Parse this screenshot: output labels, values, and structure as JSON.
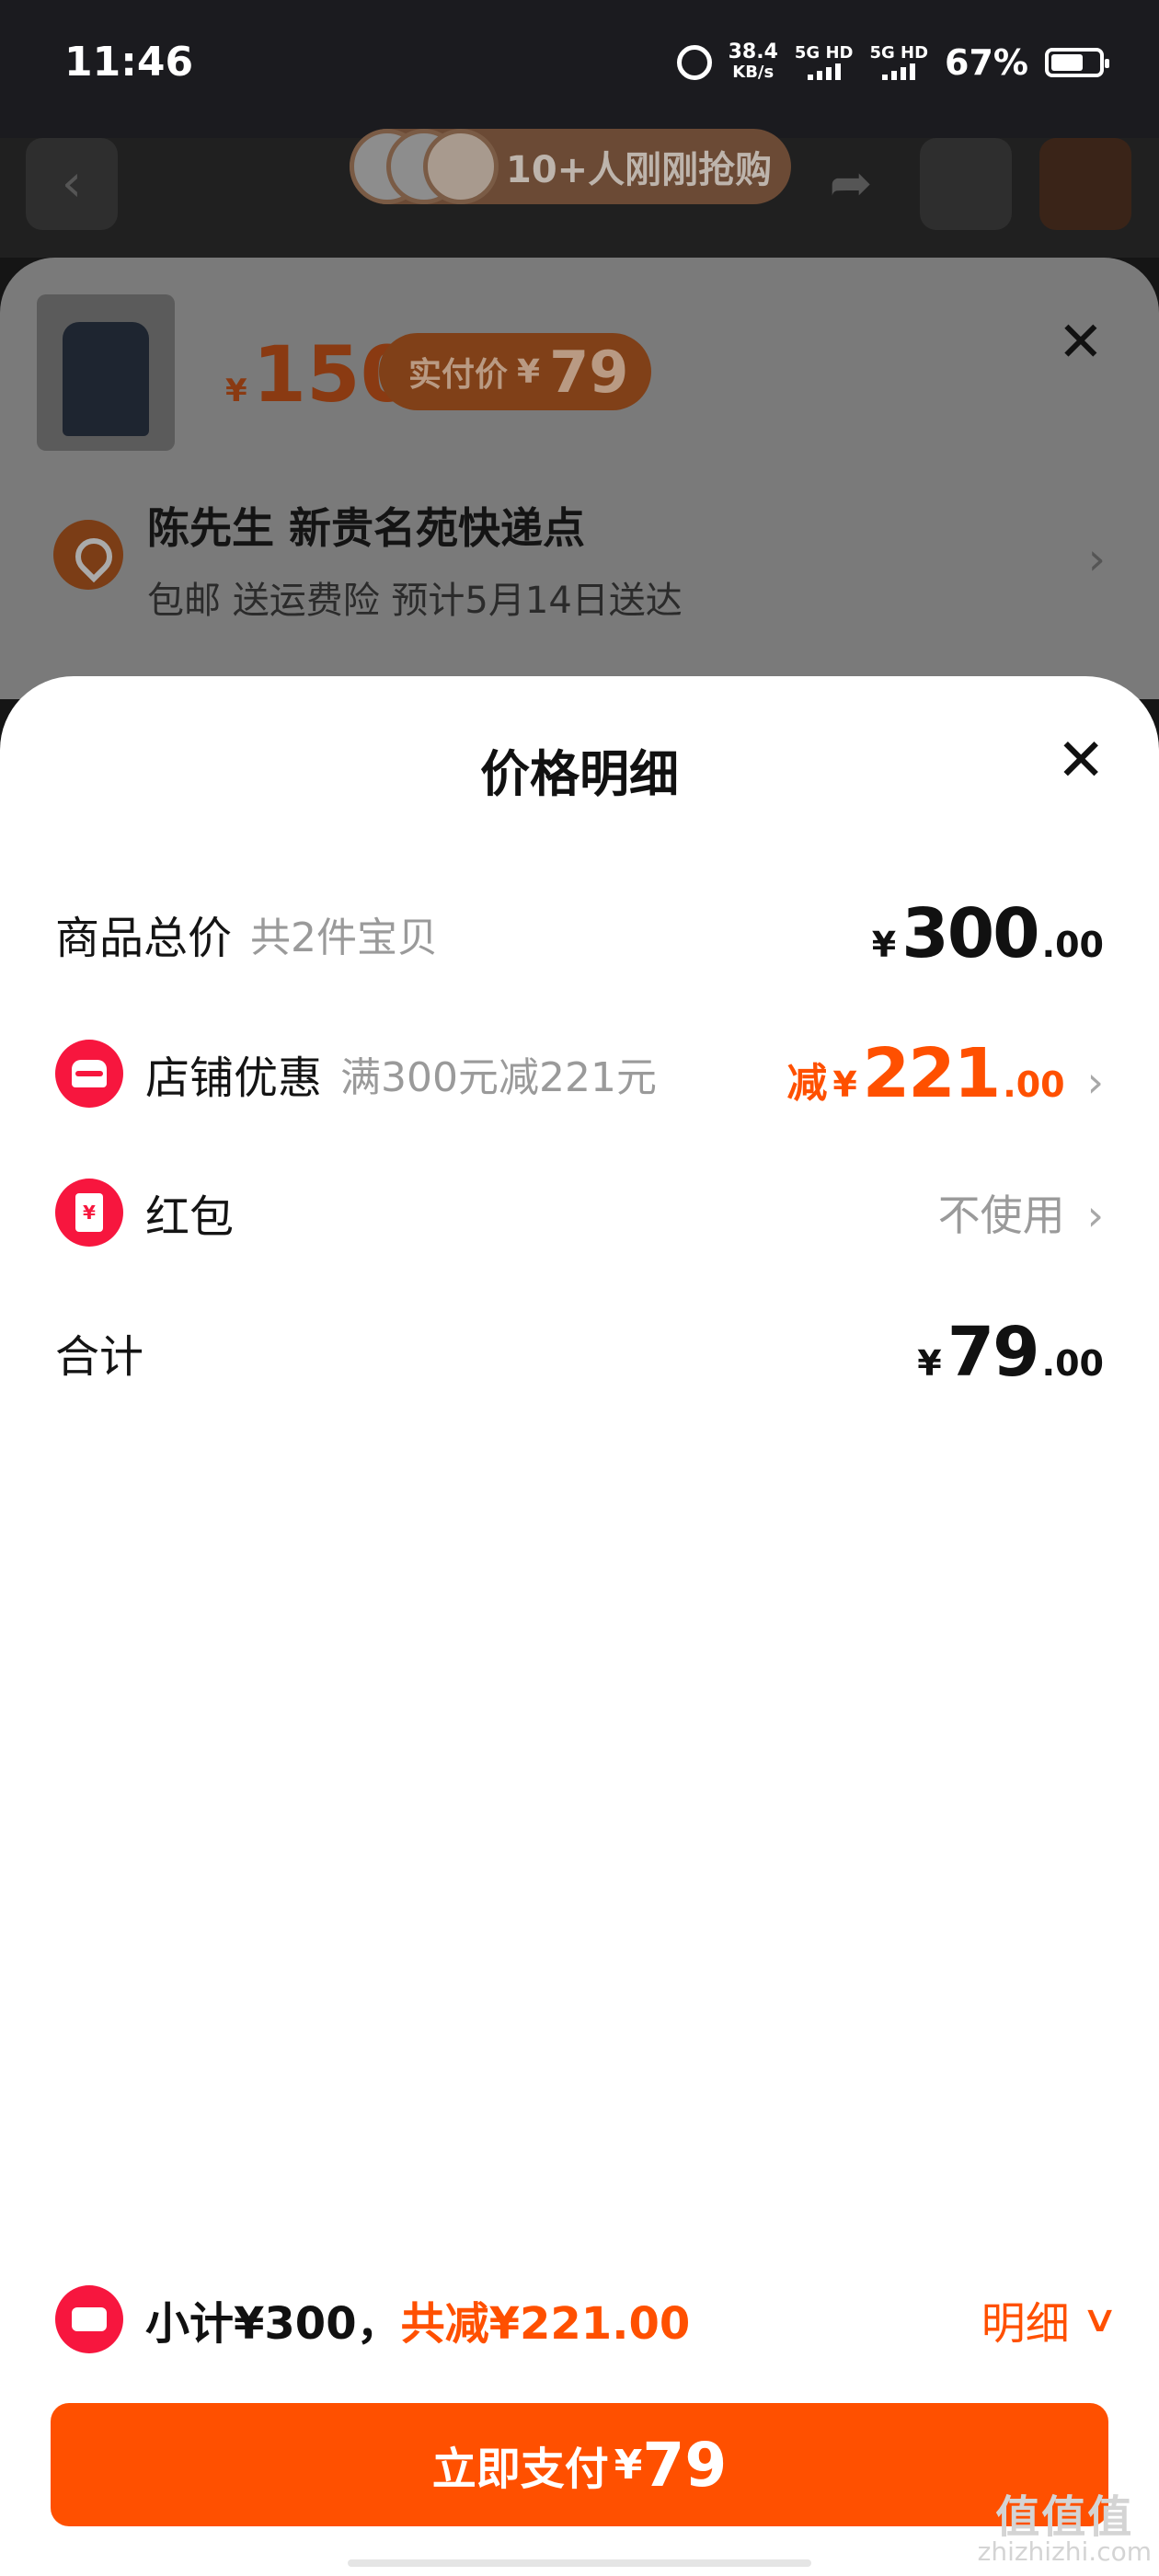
{
  "status_bar": {
    "time": "11:46",
    "net_speed": "38.4",
    "net_unit": "KB/s",
    "sim1": "5G HD",
    "sim2": "5G HD",
    "battery": "67%"
  },
  "background": {
    "buyers_text": "10+人刚刚抢购",
    "sku": {
      "currency": "¥",
      "price": "150",
      "paid_label": "实付价",
      "paid_currency": "¥",
      "paid_price": "79"
    },
    "address": {
      "name": "陈先生 新贵名苑快递点",
      "desc": "包邮 送运费险 预计5月14日送达"
    }
  },
  "sheet": {
    "title": "价格明细",
    "rows": [
      {
        "label": "商品总价",
        "sub": "共2件宝贝",
        "currency": "¥",
        "integer": "300",
        "decimal": ".00"
      },
      {
        "label": "店铺优惠",
        "sub": "满300元减221元",
        "prefix": "减",
        "currency": "¥",
        "integer": "221",
        "decimal": ".00"
      },
      {
        "label": "红包",
        "value": "不使用"
      },
      {
        "label": "合计",
        "currency": "¥",
        "integer": "79",
        "decimal": ".00"
      }
    ],
    "redpacket_glyph": "¥"
  },
  "footer": {
    "subtotal": "小计¥300，",
    "reduction": "共减¥221.00",
    "detail_label": "明细",
    "pay_label": "立即支付",
    "pay_currency": "¥",
    "pay_amount": "79"
  },
  "watermark": {
    "big": "值值值",
    "small": "zhizhizhi.com"
  },
  "colors": {
    "accent": "#ff5000",
    "icon_red": "#f7163e",
    "muted": "#9a9a9a"
  },
  "icons": [
    "alarm-icon",
    "signal-icon",
    "battery-icon",
    "back-icon",
    "share-icon",
    "cart-icon",
    "close-icon",
    "location-icon",
    "store-icon",
    "red-packet-icon",
    "coupon-icon",
    "chevron-right-icon",
    "chevron-down-icon"
  ]
}
